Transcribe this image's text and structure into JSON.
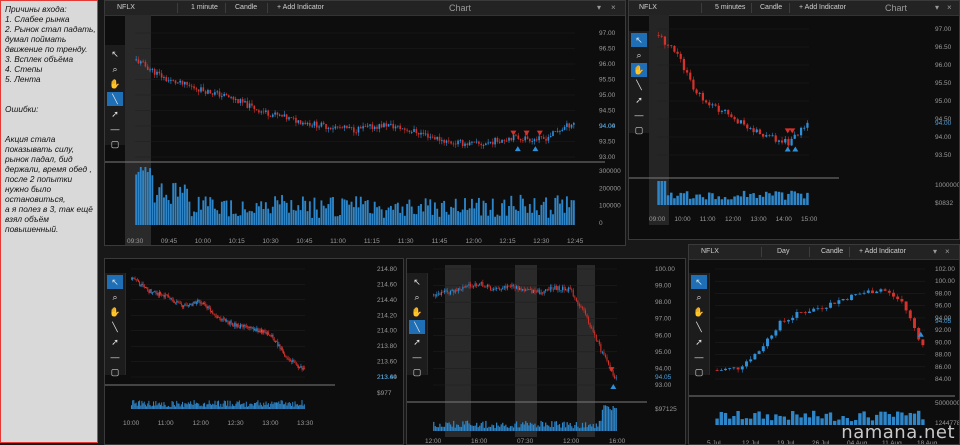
{
  "notes": {
    "lines": [
      "Причины входа:",
      "1. Слабее рынка",
      "2. Рынок стал падать,",
      "думал поймать",
      "движение по тренду.",
      "3. Всплек объёма",
      "4. Степы",
      "5. Лента",
      "",
      "",
      "Ошибки:",
      "",
      "",
      "Акция стала",
      "показывать силу,",
      "рынок падал, бид",
      "держали, время обед ,",
      "после 2 попытки",
      "нужно было",
      "остановиться,",
      "а я полез в 3, так ещё",
      "взял объём",
      "повышенный."
    ]
  },
  "watermark": "namana.net",
  "colors": {
    "up": "#2f8fd8",
    "down": "#d6312b",
    "bg": "#0d0d0d",
    "accent": "#1e6fb5",
    "volume": "#2e86c9"
  },
  "charts": [
    {
      "name": "chart-nflx-1min",
      "symbol": "NFLX",
      "interval": "1 minute",
      "type": "Candle",
      "add_indicator": "+ Add Indicator",
      "title": "Chart",
      "price_ticks": [
        "97.00",
        "96.50",
        "96.00",
        "95.50",
        "95.00",
        "94.50",
        "94.00",
        "93.50",
        "93.00"
      ],
      "last_price": "94.04",
      "volume_ticks": [
        "300000",
        "200000",
        "100000",
        "0"
      ],
      "time_ticks": [
        "09:30",
        "09:45",
        "10:00",
        "10:15",
        "10:30",
        "10:45",
        "11:00",
        "11:15",
        "11:30",
        "11:45",
        "12:00",
        "12:15",
        "12:30",
        "12:45"
      ]
    },
    {
      "name": "chart-nflx-5min",
      "symbol": "NFLX",
      "interval": "5 minutes",
      "type": "Candle",
      "add_indicator": "+ Add Indicator",
      "title": "Chart",
      "price_ticks": [
        "97.00",
        "96.50",
        "96.00",
        "95.50",
        "95.00",
        "94.50",
        "94.00",
        "93.50"
      ],
      "last_price": "94.00",
      "volume_ticks": [
        "10000000",
        "$0832"
      ],
      "time_ticks": [
        "09:00",
        "10:00",
        "11:00",
        "12:00",
        "13:00",
        "14:00",
        "15:00"
      ]
    },
    {
      "name": "chart-market",
      "price_ticks": [
        "214.80",
        "214.60",
        "214.40",
        "214.20",
        "214.00",
        "213.80",
        "213.60",
        "213.40"
      ],
      "last_price": "213.64",
      "volume_ticks": [
        "$977"
      ],
      "time_ticks": [
        "10:00",
        "11:00",
        "12:00",
        "12:30",
        "13:00",
        "13:30"
      ]
    },
    {
      "name": "chart-nflx-multiday",
      "price_ticks": [
        "100.00",
        "99.00",
        "98.00",
        "97.00",
        "96.00",
        "95.00",
        "94.00",
        "93.00"
      ],
      "last_price": "94.05",
      "volume_ticks": [
        "$97125"
      ],
      "time_ticks": [
        "12:00",
        "16:00",
        "07:30",
        "12:00",
        "16:00"
      ]
    },
    {
      "name": "chart-nflx-day",
      "symbol": "NFLX",
      "interval": "Day",
      "type": "Candle",
      "add_indicator": "+ Add Indicator",
      "price_ticks": [
        "102.00",
        "100.00",
        "98.00",
        "96.00",
        "94.00",
        "92.00",
        "90.00",
        "88.00",
        "86.00",
        "84.00"
      ],
      "last_price": "94.05",
      "volume_ticks": [
        "50000000",
        "1244778"
      ],
      "time_ticks": [
        "5 Jul",
        "12 Jul",
        "19 Jul",
        "26 Jul",
        "04 Aug",
        "11 Aug",
        "18 Aug"
      ]
    }
  ]
}
